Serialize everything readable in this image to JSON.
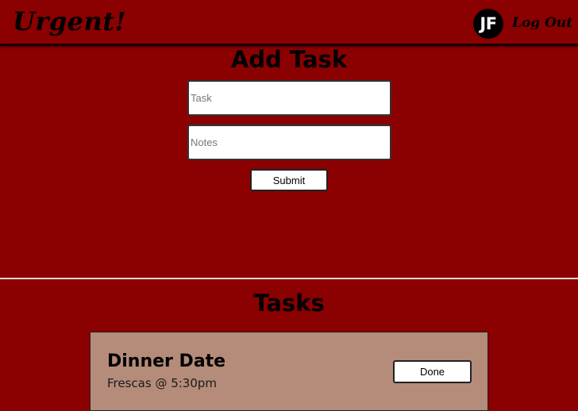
{
  "header": {
    "brand": "Urgent!",
    "avatar_initials": "JF",
    "logout_label": "Log Out"
  },
  "add_task": {
    "title": "Add Task",
    "task_placeholder": "Task",
    "task_value": "",
    "notes_placeholder": "Notes",
    "notes_value": "",
    "submit_label": "Submit"
  },
  "tasks": {
    "title": "Tasks",
    "items": [
      {
        "name": "Dinner Date",
        "notes": "Frescas @ 5:30pm",
        "done_label": "Done"
      }
    ]
  },
  "colors": {
    "background": "#8b0000",
    "card": "#b58b7a",
    "divider": "#e8d6d6"
  }
}
